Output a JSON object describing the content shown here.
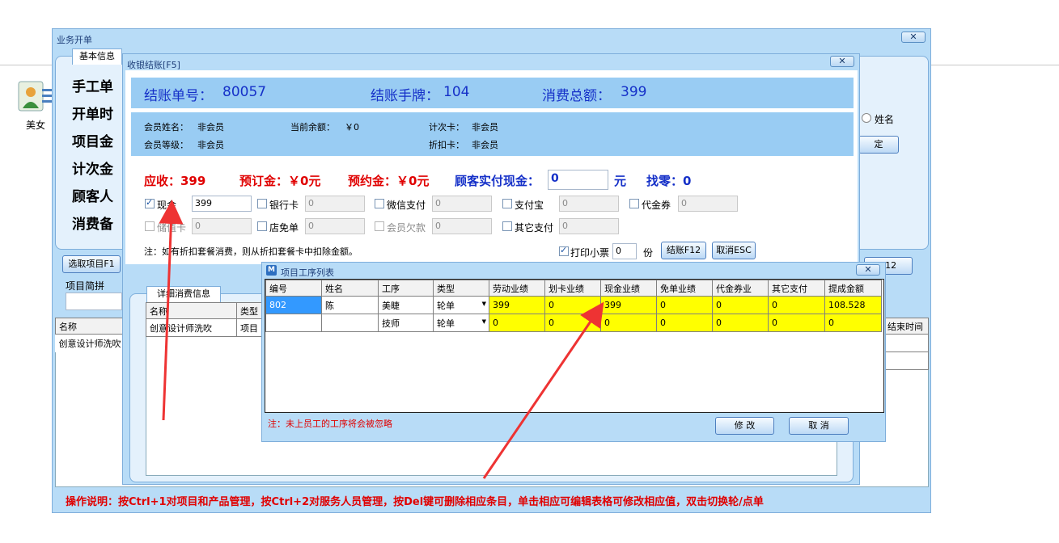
{
  "desktop": {
    "icon_label": "美女"
  },
  "outer_window": {
    "title": "业务开单",
    "tab": "基本信息",
    "fields": [
      "手工单",
      "开单时",
      "项目金",
      "计次金",
      "顾客人",
      "消费备"
    ],
    "radio_label": "姓名",
    "confirm_label": "定",
    "select_project_btn": "选取项目F1",
    "project_abbr_label": "项目简拼",
    "detail_tab": "详细消费信息",
    "inner_headers": [
      "名称",
      "类型"
    ],
    "inner_row": [
      "创意设计师洗吹",
      "项目"
    ],
    "left_headers": [
      "名称"
    ],
    "left_row": [
      "创意设计师洗吹"
    ],
    "end_time_header": "结束时间",
    "f12_btn": "F12",
    "instructions": "操作说明：按Ctrl+1对项目和产品管理，按Ctrl+2对服务人员管理，按Del键可删除相应条目，单击相应可编辑表格可修改相应值，双击切换轮/点单"
  },
  "checkout": {
    "title": "收银结账[F5]",
    "order_no_label": "结账单号：",
    "order_no": "80057",
    "tag_label": "结账手牌：",
    "tag_no": "104",
    "total_label": "消费总额：",
    "total": "399",
    "member_name_label": "会员姓名：",
    "member_name": "非会员",
    "balance_label": "当前余额：",
    "balance": "￥0",
    "count_card_label": "计次卡：",
    "count_card": "非会员",
    "member_level_label": "会员等级：",
    "member_level": "非会员",
    "discount_card_label": "折扣卡：",
    "discount_card": "非会员",
    "receivable": "应收：399",
    "deposit": "预订金：￥0元",
    "appointment": "预约金：￥0元",
    "cash_paid_label": "顾客实付现金：",
    "cash_paid_value": "0",
    "yuan": "元",
    "change": "找零：0",
    "pay_methods": [
      {
        "label": "现金",
        "value": "399",
        "checked": true,
        "enabled": true
      },
      {
        "label": "银行卡",
        "value": "0",
        "checked": false,
        "enabled": true
      },
      {
        "label": "微信支付",
        "value": "0",
        "checked": false,
        "enabled": true
      },
      {
        "label": "支付宝",
        "value": "0",
        "checked": false,
        "enabled": true
      },
      {
        "label": "代金券",
        "value": "0",
        "checked": false,
        "enabled": true
      },
      {
        "label": "储值卡",
        "value": "0",
        "checked": false,
        "enabled": false
      },
      {
        "label": "店免单",
        "value": "0",
        "checked": false,
        "enabled": true
      },
      {
        "label": "会员欠款",
        "value": "0",
        "checked": false,
        "enabled": false
      },
      {
        "label": "其它支付",
        "value": "0",
        "checked": false,
        "enabled": true
      }
    ],
    "note": "注：如有折扣套餐消费，则从折扣套餐卡中扣除金额。",
    "print_label": "打印小票",
    "print_copies": "0",
    "copies_unit": "份",
    "checkout_btn": "结账F12",
    "cancel_btn": "取消ESC"
  },
  "process_list": {
    "title": "项目工序列表",
    "headers": [
      "编号",
      "姓名",
      "工序",
      "类型",
      "劳动业绩",
      "划卡业绩",
      "现金业绩",
      "免单业绩",
      "代金券业",
      "其它支付",
      "提成金额"
    ],
    "rows": [
      [
        "802",
        "陈",
        "美睫",
        "轮单",
        "399",
        "0",
        "399",
        "0",
        "0",
        "0",
        "108.528"
      ],
      [
        "",
        "",
        "技师",
        "轮单",
        "0",
        "0",
        "0",
        "0",
        "0",
        "0",
        "0"
      ]
    ],
    "note": "注：未上员工的工序将会被忽略",
    "modify_btn": "修 改",
    "cancel_btn": "取 消"
  },
  "colors": {
    "panel_blue": "#99ccf3",
    "window_blue": "#b8dcf7",
    "red_text": "#e00000",
    "blue_text": "#1530c8"
  }
}
